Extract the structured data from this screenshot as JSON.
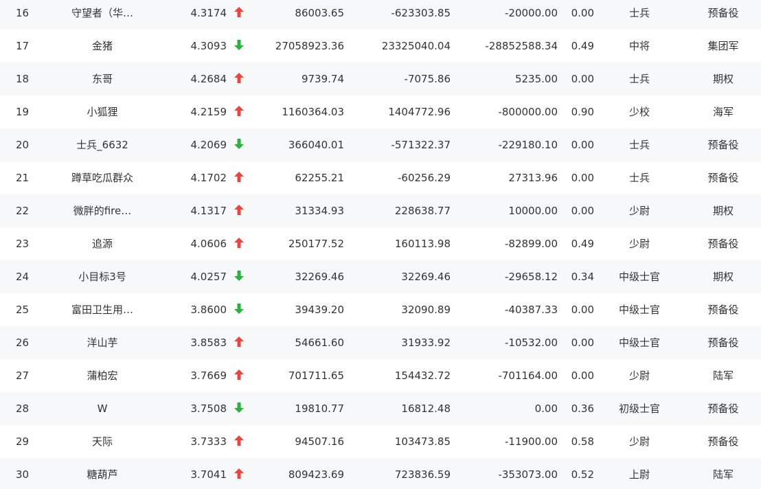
{
  "colors": {
    "up": "#e8453c",
    "down": "#27b33d",
    "alt_row": "#f7f8fa"
  },
  "rows": [
    {
      "rank": "16",
      "name": "守望者（华…",
      "score": "4.3174",
      "trend": "up",
      "trend_icon": "arrow-up-icon",
      "v1": "86003.65",
      "v2": "-623303.85",
      "v3": "-20000.00",
      "v4": "0.00",
      "rank_title": "士兵",
      "branch": "预备役"
    },
    {
      "rank": "17",
      "name": "金猪",
      "score": "4.3093",
      "trend": "down",
      "trend_icon": "arrow-down-icon",
      "v1": "27058923.36",
      "v2": "23325040.04",
      "v3": "-28852588.34",
      "v4": "0.49",
      "rank_title": "中将",
      "branch": "集团军"
    },
    {
      "rank": "18",
      "name": "东哥",
      "score": "4.2684",
      "trend": "up",
      "trend_icon": "arrow-up-icon",
      "v1": "9739.74",
      "v2": "-7075.86",
      "v3": "5235.00",
      "v4": "0.00",
      "rank_title": "士兵",
      "branch": "期权"
    },
    {
      "rank": "19",
      "name": "小狐狸",
      "score": "4.2159",
      "trend": "up",
      "trend_icon": "arrow-up-icon",
      "v1": "1160364.03",
      "v2": "1404772.96",
      "v3": "-800000.00",
      "v4": "0.90",
      "rank_title": "少校",
      "branch": "海军"
    },
    {
      "rank": "20",
      "name": "士兵_6632",
      "score": "4.2069",
      "trend": "down",
      "trend_icon": "arrow-down-icon",
      "v1": "366040.01",
      "v2": "-571322.37",
      "v3": "-229180.10",
      "v4": "0.00",
      "rank_title": "士兵",
      "branch": "预备役"
    },
    {
      "rank": "21",
      "name": "蹲草吃瓜群众",
      "score": "4.1702",
      "trend": "up",
      "trend_icon": "arrow-up-icon",
      "v1": "62255.21",
      "v2": "-60256.29",
      "v3": "27313.96",
      "v4": "0.00",
      "rank_title": "士兵",
      "branch": "预备役"
    },
    {
      "rank": "22",
      "name": "微胖的fire…",
      "score": "4.1317",
      "trend": "up",
      "trend_icon": "arrow-up-icon",
      "v1": "31334.93",
      "v2": "228638.77",
      "v3": "10000.00",
      "v4": "0.00",
      "rank_title": "少尉",
      "branch": "期权"
    },
    {
      "rank": "23",
      "name": "追源",
      "score": "4.0606",
      "trend": "up",
      "trend_icon": "arrow-up-icon",
      "v1": "250177.52",
      "v2": "160113.98",
      "v3": "-82899.00",
      "v4": "0.49",
      "rank_title": "少尉",
      "branch": "预备役"
    },
    {
      "rank": "24",
      "name": "小目标3号",
      "score": "4.0257",
      "trend": "down",
      "trend_icon": "arrow-down-icon",
      "v1": "32269.46",
      "v2": "32269.46",
      "v3": "-29658.12",
      "v4": "0.34",
      "rank_title": "中级士官",
      "branch": "期权"
    },
    {
      "rank": "25",
      "name": "富田卫生用…",
      "score": "3.8600",
      "trend": "down",
      "trend_icon": "arrow-down-icon",
      "v1": "39439.20",
      "v2": "32090.89",
      "v3": "-40387.33",
      "v4": "0.00",
      "rank_title": "中级士官",
      "branch": "预备役"
    },
    {
      "rank": "26",
      "name": "洋山芋",
      "score": "3.8583",
      "trend": "up",
      "trend_icon": "arrow-up-icon",
      "v1": "54661.60",
      "v2": "31933.92",
      "v3": "-10532.00",
      "v4": "0.00",
      "rank_title": "中级士官",
      "branch": "预备役"
    },
    {
      "rank": "27",
      "name": "蒲柏宏",
      "score": "3.7669",
      "trend": "up",
      "trend_icon": "arrow-up-icon",
      "v1": "701711.65",
      "v2": "154432.72",
      "v3": "-701164.00",
      "v4": "0.00",
      "rank_title": "少尉",
      "branch": "陆军"
    },
    {
      "rank": "28",
      "name": "W",
      "score": "3.7508",
      "trend": "down",
      "trend_icon": "arrow-down-icon",
      "v1": "19810.77",
      "v2": "16812.48",
      "v3": "0.00",
      "v4": "0.36",
      "rank_title": "初级士官",
      "branch": "预备役"
    },
    {
      "rank": "29",
      "name": "天际",
      "score": "3.7333",
      "trend": "up",
      "trend_icon": "arrow-up-icon",
      "v1": "94507.16",
      "v2": "103473.85",
      "v3": "-11900.00",
      "v4": "0.58",
      "rank_title": "少尉",
      "branch": "预备役"
    },
    {
      "rank": "30",
      "name": "糖葫芦",
      "score": "3.7041",
      "trend": "up",
      "trend_icon": "arrow-up-icon",
      "v1": "809423.69",
      "v2": "723836.59",
      "v3": "-353073.00",
      "v4": "0.52",
      "rank_title": "上尉",
      "branch": "陆军"
    }
  ]
}
